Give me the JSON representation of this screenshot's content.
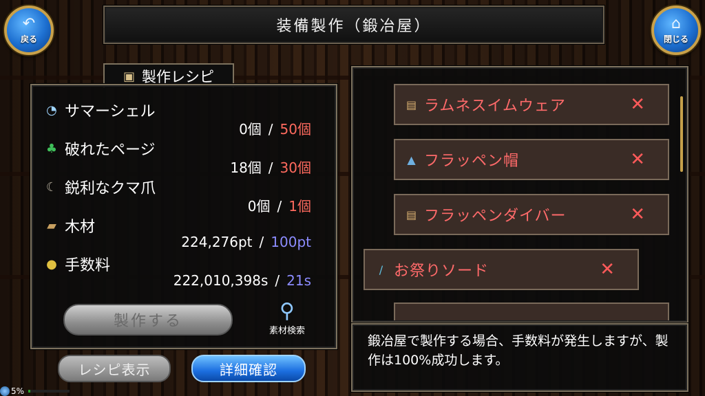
{
  "header": {
    "title": "装備製作（鍛冶屋）"
  },
  "back_button": {
    "label": "戻る",
    "icon": "back-arrow-icon"
  },
  "close_button": {
    "label": "閉じる",
    "icon": "home-icon"
  },
  "recipe": {
    "title": "製作レシピ",
    "materials": [
      {
        "name": "サマーシェル",
        "icon": "shell-icon",
        "have": "0個",
        "need": "50個",
        "need_color": "#ff6a5e"
      },
      {
        "name": "破れたページ",
        "icon": "leaf-icon",
        "have": "18個",
        "need": "30個",
        "need_color": "#ff6a5e"
      },
      {
        "name": "鋭利なクマ爪",
        "icon": "claw-icon",
        "have": "0個",
        "need": "1個",
        "need_color": "#ff6a5e"
      },
      {
        "name": "木材",
        "icon": "wood-icon",
        "have": "224,276pt",
        "need": "100pt",
        "need_color": "#8c8cff"
      },
      {
        "name": "手数料",
        "icon": "coin-icon",
        "have": "222,010,398s",
        "need": "21s",
        "need_color": "#8c8cff"
      }
    ],
    "separator": "/",
    "craft_label": "製作する",
    "search_label": "素材検索"
  },
  "bottom_buttons": {
    "recipe_show": "レシピ表示",
    "detail": "詳細確認"
  },
  "items": [
    {
      "name": "ラムネスイムウェア",
      "icon": "scroll-icon",
      "remove": "✕"
    },
    {
      "name": "フラッペン帽",
      "icon": "hat-icon",
      "remove": "✕"
    },
    {
      "name": "フラッペンダイバー",
      "icon": "scroll-icon",
      "remove": "✕"
    },
    {
      "name": "お祭りソード",
      "icon": "sword-icon",
      "remove": "✕"
    }
  ],
  "message": {
    "text": "鍛冶屋で製作する場合、手数料が発生しますが、製作は100%成功します。"
  },
  "status": {
    "percent": "5%",
    "progress": 0.05
  }
}
